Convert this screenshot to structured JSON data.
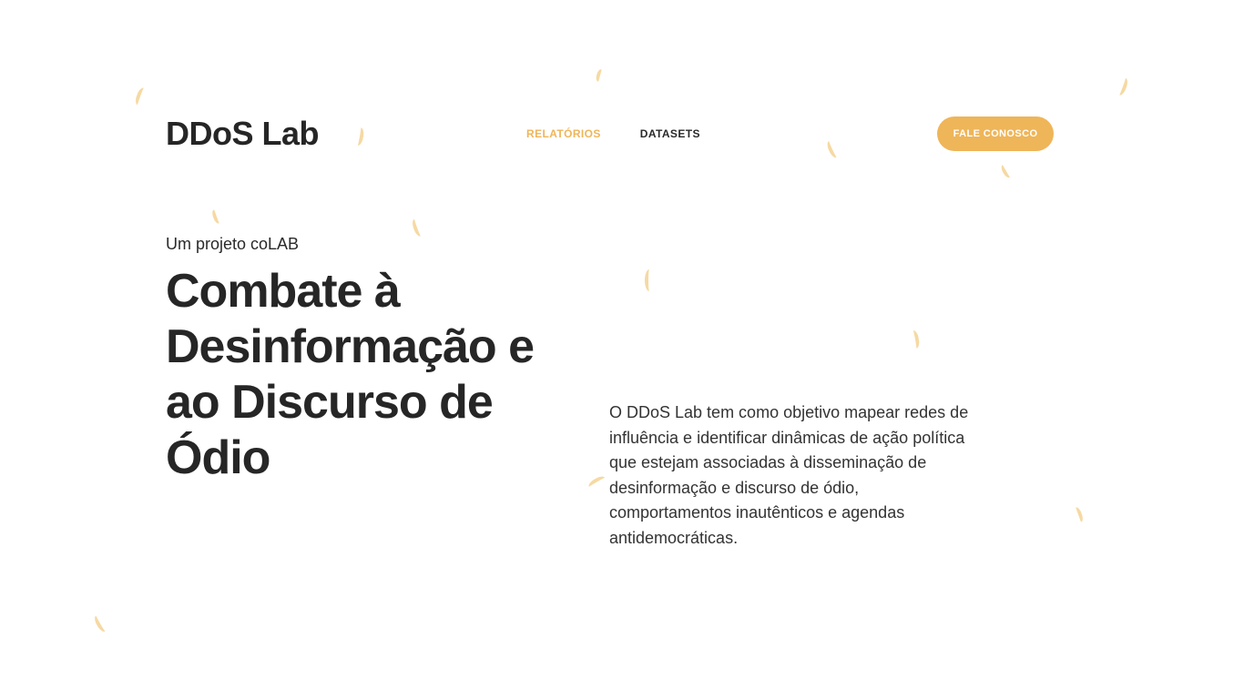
{
  "header": {
    "logo": "DDoS Lab",
    "nav": [
      {
        "label": "RELATÓRIOS",
        "active": true
      },
      {
        "label": "DATASETS",
        "active": false
      }
    ],
    "cta_label": "FALE CONOSCO"
  },
  "hero": {
    "eyebrow": "Um projeto coLAB",
    "headline": "Combate à Desinformação e ao Discurso de Ódio",
    "description": "O DDoS Lab tem como objetivo mapear redes de influência e identificar dinâmicas de ação política que estejam associadas à disseminação de desinformação e discurso de ódio, comportamentos inautênticos e agendas antidemocráticas."
  },
  "colors": {
    "accent": "#efb559",
    "confetti": "#f6d9a3",
    "text": "#262626",
    "background": "#ffffff"
  }
}
